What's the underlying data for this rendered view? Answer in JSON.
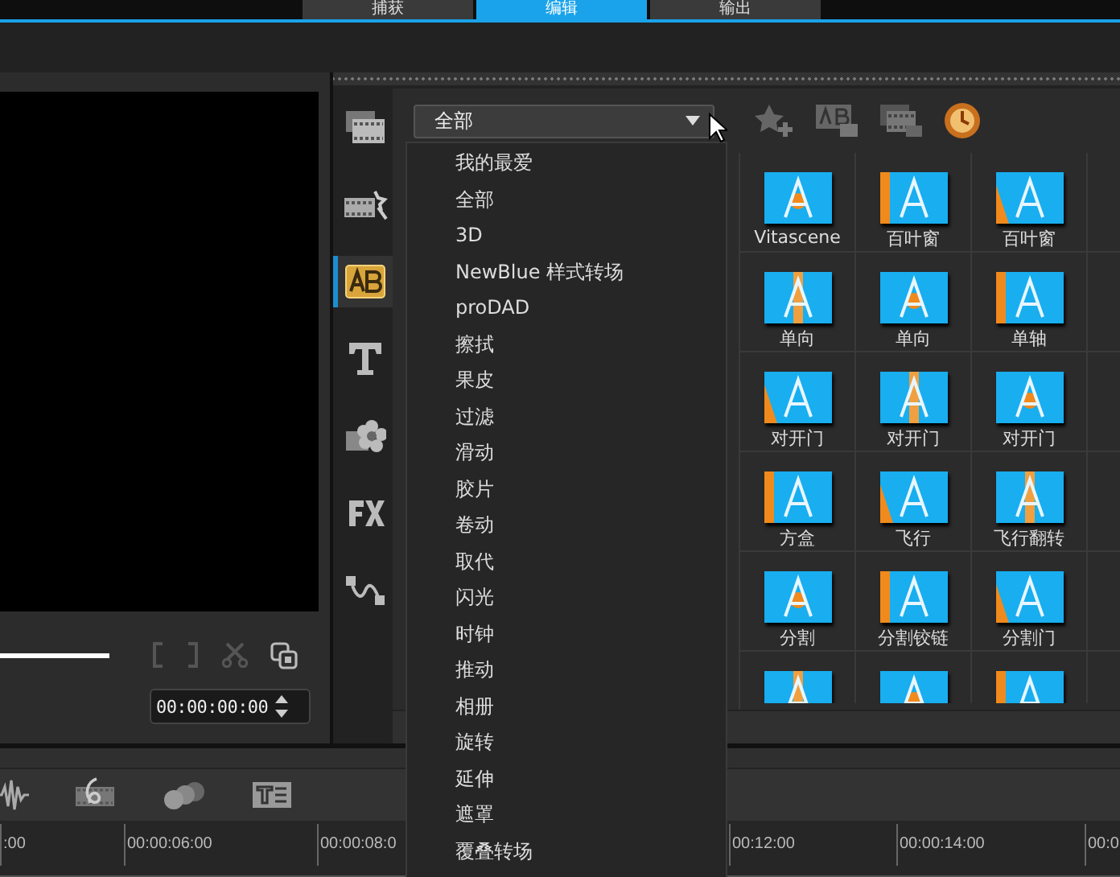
{
  "top_tabs": [
    {
      "label": "捕获",
      "selected": false
    },
    {
      "label": "编辑",
      "selected": true
    },
    {
      "label": "输出",
      "selected": false
    }
  ],
  "preview": {
    "timecode": "00:00:00:00"
  },
  "library": {
    "sidebar": {
      "items": [
        {
          "kind": "media",
          "selected": false
        },
        {
          "kind": "instant",
          "selected": false
        },
        {
          "kind": "transition",
          "selected": true
        },
        {
          "kind": "title",
          "selected": false
        },
        {
          "kind": "graphic",
          "selected": false
        },
        {
          "kind": "fx",
          "selected": false
        },
        {
          "kind": "path",
          "selected": false
        }
      ]
    },
    "category_dropdown": {
      "value": "全部",
      "options": [
        "我的最爱",
        "全部",
        "3D",
        "NewBlue 样式转场",
        "proDAD",
        "擦拭",
        "果皮",
        "过滤",
        "滑动",
        "胶片",
        "卷动",
        "取代",
        "闪光",
        "时钟",
        "推动",
        "相册",
        "旋转",
        "延伸",
        "遮罩",
        "覆叠转场"
      ]
    },
    "transitions": [
      {
        "label": "Vitascene"
      },
      {
        "label": "百叶窗"
      },
      {
        "label": "百叶窗"
      },
      {
        "label": "单向"
      },
      {
        "label": "单向"
      },
      {
        "label": "单轴"
      },
      {
        "label": "对开门"
      },
      {
        "label": "对开门"
      },
      {
        "label": "对开门"
      },
      {
        "label": "方盒"
      },
      {
        "label": "飞行"
      },
      {
        "label": "飞行翻转"
      },
      {
        "label": "分割"
      },
      {
        "label": "分割铰链"
      },
      {
        "label": "分割门"
      },
      {
        "kind": "picture"
      },
      {
        "kind": "picture"
      },
      {
        "kind": "picture"
      }
    ]
  },
  "timeline": {
    "ruler": [
      ":00",
      "00:00:06:00",
      "00:00:08:0",
      "00:12:00",
      "00:00:14:00",
      "00:0"
    ]
  }
}
